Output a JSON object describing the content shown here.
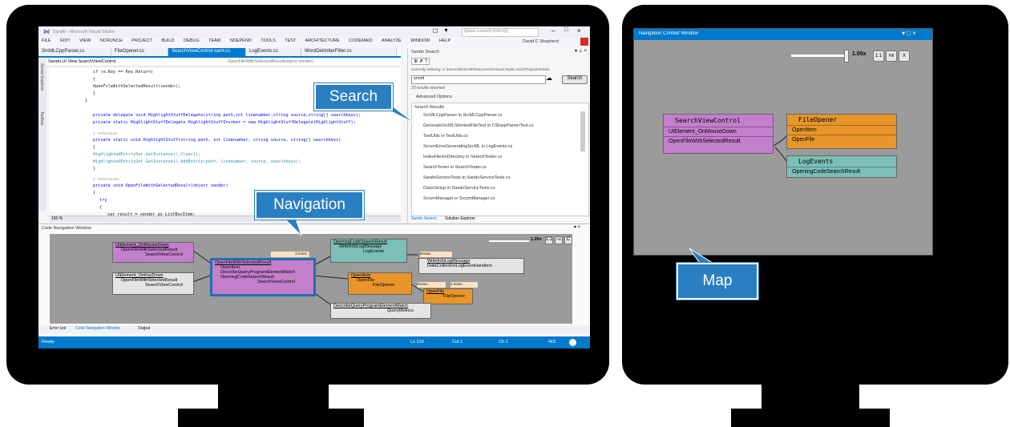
{
  "vs": {
    "title": "Sando - Microsoft Visual Studio",
    "quick_launch": "Quick Launch (Ctrl+Q)",
    "user": "David C Shepherd",
    "menu": [
      "FILE",
      "EDIT",
      "VIEW",
      "NCRUNCH",
      "PROJECT",
      "BUILD",
      "DEBUG",
      "TEAM",
      "NDEPEND",
      "TOOLS",
      "TEST",
      "ARCHITECTURE",
      "CODEMAID",
      "ANALYZE",
      "WINDOW",
      "HELP"
    ],
    "tabs": [
      "SrcMLCppParser.cs",
      "FileOpener.cs",
      "SearchViewControl.xaml.cs",
      "LogEvents.cs",
      "WordDelimiterFilter.cs"
    ],
    "breadcrumb_left": "Sando.UI.View.SearchViewControl",
    "breadcrumb_right": "OpenFileWithSelectedResult(object sender)",
    "side_labels": [
      "Server Explorer",
      "Toolbox"
    ],
    "code_lines": [
      "if (e.Key == Key.Return)",
      "{",
      "    OpenFileWithSelectedResult(sender);",
      "}",
      "}",
      "private delegate void HighlightStuffDelegate(string path,int linenumber,string source,string[] searchkeys);",
      "private static HighlightStuffDelegate HighlightStuffInvoker = new HighlightStuffDelegate(HighlightStuff);",
      "1 reference",
      "private static void HighlightStuff(string path, int linenumber, string source, string[] searchkeys)",
      "{",
      "    HighlightedEntitySet.GetInstance().Clear();",
      "    HighlightedEntitySet.GetInstance().AddEntity(path, linenumber, source, searchkeys);",
      "}",
      "2 references",
      "private void OpenFileWithSelectedResult(object sender)",
      "{",
      "    try",
      "    {",
      "        var result = sender as ListBoxItem;"
    ],
    "zoom": "100 %",
    "sando": {
      "title": "Sando Search",
      "indexing": "Currently Indexing: C:\\Users\\SDAGHEI\\Documents\\Visual Studio 2012\\Projects\\Sando",
      "query": "srcml",
      "search_button": "Search",
      "results_count": "20 results returned",
      "advanced": "Advanced Options",
      "results_header": "Search Results",
      "results": [
        "SrcMLCppParser in SrcMLCppParser.cs",
        "GenerateSrcMLShortestFileTest in CSharpParserTest.cs",
        "TestUtils in TestUtils.cs",
        "SrcumErrorGeneratingSrcML in LogEvents.cs",
        "IndexFilesInDirectory in SearchTester.cs",
        "SearchTester in SearchTester.cs",
        "SandoServiceTests in SandoServiceTests.cs",
        "ClassSetup in SandoServiceTests.cs",
        "SrcumManager in SrcumManager.cs"
      ],
      "bottom_tabs": [
        "Sando Search",
        "Solution Explorer"
      ]
    },
    "nav_window": {
      "title": "Code Navigation Window",
      "zoom": "1.00x",
      "btn_11": "1:1",
      "btn_fill": "Fill",
      "btn_close": "C",
      "nodes": {
        "ui_mousedown": {
          "title": "UIElement_OnMouseDown",
          "lines": [
            "OpenFileWithSelectedResult",
            "SearchViewControl"
          ]
        },
        "ui_keydown": {
          "title": "UIElement_OnKeyDown",
          "lines": [
            "OpenFileWithSelectedResult",
            "SearchViewControl"
          ]
        },
        "open_file": {
          "title": "OpenFileWithSelectedResult",
          "lines": [
            "OpenItem",
            "DescribeQueryProgramElementMatch",
            "OpeningCodeSearchResult",
            "SearchViewControl"
          ]
        },
        "opening_code": {
          "title": "OpeningCodeSearchResult",
          "lines": [
            "WriteInfoLogMessage",
            "LogEvents"
          ]
        },
        "write_info": {
          "title": "WriteInfoLogMessage",
          "lines": [
            "DataCollectionLogEventHandlers"
          ]
        },
        "open_item": {
          "title": "OpenItem",
          "lines": [
            "OpenFile",
            "FileOpener"
          ]
        },
        "open_file2": {
          "title": "OpenFile",
          "lines": [
            "FileOpener"
          ]
        },
        "describe": {
          "title": "DescribeQueryProgramElementMatch",
          "lines": [
            "QueryMetrics"
          ]
        },
        "more1": "2 more...",
        "more2": "Enrow...",
        "more3": "Enrow...",
        "more4": "1 more..."
      }
    },
    "bottom_tabs": [
      "Error List",
      "Code Navigation Window",
      "Output"
    ],
    "status": {
      "ready": "Ready",
      "ln": "Ln 316",
      "col": "Col 1",
      "ch": "Ch 1",
      "ins": "INS"
    }
  },
  "nav_context": {
    "title": "Navigation Context Window",
    "zoom": "1.00x",
    "btn_11": "1:1",
    "btn_fill": "Fill",
    "btn_close": "X",
    "search_view": {
      "title": "SearchViewControl",
      "lines": [
        "UIElement_OnMouseDown",
        "OpenFileWithSelectedResult"
      ]
    },
    "file_opener": {
      "title": "FileOpener",
      "lines": [
        "OpenItem",
        "OpenFile"
      ]
    },
    "log_events": {
      "title": "LogEvents",
      "lines": [
        "OpeningCodeSearchResult"
      ]
    }
  },
  "callouts": {
    "search": "Search",
    "navigation": "Navigation",
    "map": "Map"
  },
  "colors": {
    "vs_blue": "#007acc",
    "callout_blue": "#2a7fc2",
    "purple": "#c47fcc",
    "orange": "#e8962a",
    "teal": "#7bbfb8"
  }
}
